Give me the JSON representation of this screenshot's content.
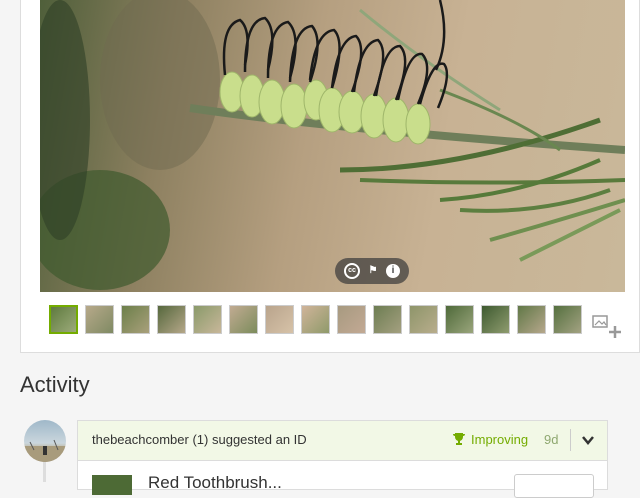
{
  "photo": {
    "badges": {
      "license_icon": "creative-commons-icon",
      "flag_icon": "flag-icon",
      "info_icon": "info-icon"
    },
    "thumbnail_count": 15,
    "selected_thumbnail": 1
  },
  "activity": {
    "title": "Activity",
    "items": [
      {
        "user": "thebeachcomber",
        "user_count": "(1)",
        "action": "suggested an ID",
        "status": "Improving",
        "time": "9d",
        "taxon_name": "Red Toothbrush..."
      }
    ]
  },
  "colors": {
    "accent": "#74ac00",
    "header_bg": "#f2f8e6"
  }
}
